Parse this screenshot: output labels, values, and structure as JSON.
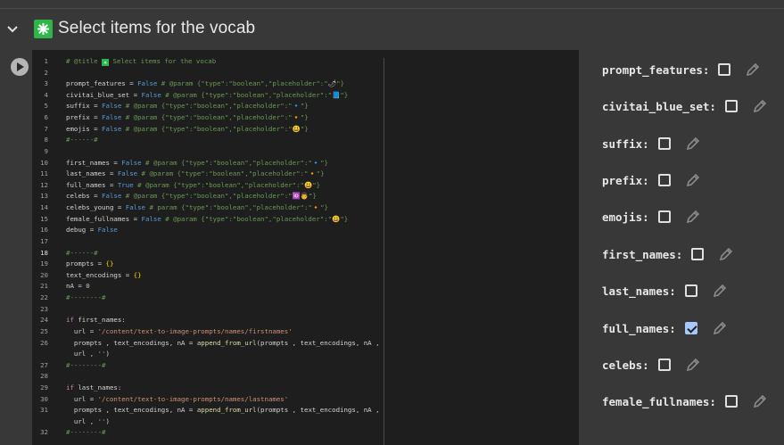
{
  "header": {
    "title": "Select items for the vocab",
    "title_emoji": "✳",
    "chevron_icon": "chevron-down-icon"
  },
  "code_lines": [
    {
      "n": "1",
      "segs": [
        [
          "cm",
          "# @title "
        ],
        [
          "em",
          "✳"
        ],
        [
          "cm",
          " Select items for the vocab"
        ]
      ]
    },
    {
      "n": "2",
      "segs": []
    },
    {
      "n": "3",
      "segs": [
        [
          "pl",
          "prompt_features = "
        ],
        [
          "bl",
          "False"
        ],
        [
          "cm",
          " # @param {\"type\":\"boolean\",\"placeholder\":\""
        ],
        [
          "pl",
          "🌶"
        ],
        [
          "cm",
          "\"}"
        ]
      ]
    },
    {
      "n": "4",
      "segs": [
        [
          "pl",
          "civitai_blue_set = "
        ],
        [
          "bl",
          "False"
        ],
        [
          "cm",
          " # @param {\"type\":\"boolean\",\"placeholder\":\""
        ],
        [
          "pl",
          "📘"
        ],
        [
          "cm",
          "\"}"
        ]
      ]
    },
    {
      "n": "5",
      "segs": [
        [
          "pl",
          "suffix = "
        ],
        [
          "bl",
          "False"
        ],
        [
          "cm",
          " # @param {\"type\":\"boolean\",\"placeholder\":\""
        ],
        [
          "pl",
          "🔹"
        ],
        [
          "cm",
          "\"}"
        ]
      ]
    },
    {
      "n": "6",
      "segs": [
        [
          "pl",
          "prefix = "
        ],
        [
          "bl",
          "False"
        ],
        [
          "cm",
          " # @param {\"type\":\"boolean\",\"placeholder\":\""
        ],
        [
          "pl",
          "🔸"
        ],
        [
          "cm",
          "\"}"
        ]
      ]
    },
    {
      "n": "7",
      "segs": [
        [
          "pl",
          "emojis = "
        ],
        [
          "bl",
          "False"
        ],
        [
          "cm",
          " # @param {\"type\":\"boolean\",\"placeholder\":\""
        ],
        [
          "pl",
          "😃"
        ],
        [
          "cm",
          "\"}"
        ]
      ]
    },
    {
      "n": "8",
      "segs": [
        [
          "cm",
          "#------#"
        ]
      ]
    },
    {
      "n": "9",
      "segs": []
    },
    {
      "n": "10",
      "segs": [
        [
          "pl",
          "first_names = "
        ],
        [
          "bl",
          "False"
        ],
        [
          "cm",
          " # @param {\"type\":\"boolean\",\"placeholder\":\""
        ],
        [
          "pl",
          "🔹"
        ],
        [
          "cm",
          "\"}"
        ]
      ]
    },
    {
      "n": "11",
      "segs": [
        [
          "pl",
          "last_names = "
        ],
        [
          "bl",
          "False"
        ],
        [
          "cm",
          " # @param {\"type\":\"boolean\",\"placeholder\":\""
        ],
        [
          "pl",
          "🔸"
        ],
        [
          "cm",
          "\"}"
        ]
      ]
    },
    {
      "n": "12",
      "segs": [
        [
          "pl",
          "full_names = "
        ],
        [
          "bl",
          "True"
        ],
        [
          "cm",
          " # @param {\"type\":\"boolean\",\"placeholder\":\""
        ],
        [
          "pl",
          "😃"
        ],
        [
          "cm",
          "\"}"
        ]
      ]
    },
    {
      "n": "13",
      "segs": [
        [
          "pl",
          "celebs = "
        ],
        [
          "bl",
          "False"
        ],
        [
          "cm",
          " # @param {\"type\":\"boolean\",\"placeholder\":\""
        ],
        [
          "pl",
          "🆔👨"
        ],
        [
          "cm",
          "\"}"
        ]
      ]
    },
    {
      "n": "14",
      "segs": [
        [
          "pl",
          "celebs_young = "
        ],
        [
          "bl",
          "False"
        ],
        [
          "cm",
          " # param {\"type\":\"boolean\",\"placeholder\":\""
        ],
        [
          "pl",
          "🔸"
        ],
        [
          "cm",
          "\"}"
        ]
      ]
    },
    {
      "n": "15",
      "segs": [
        [
          "pl",
          "female_fullnames = "
        ],
        [
          "bl",
          "False"
        ],
        [
          "cm",
          " # @param {\"type\":\"boolean\",\"placeholder\":\""
        ],
        [
          "pl",
          "😃"
        ],
        [
          "cm",
          "\"}"
        ]
      ]
    },
    {
      "n": "16",
      "segs": [
        [
          "pl",
          "debug = "
        ],
        [
          "bl",
          "False"
        ]
      ]
    },
    {
      "n": "17",
      "segs": []
    },
    {
      "n": "18",
      "segs": [
        [
          "cm",
          "#------#"
        ]
      ]
    },
    {
      "n": "19",
      "segs": [
        [
          "pl",
          "prompts = "
        ],
        [
          "yl",
          "{}"
        ]
      ]
    },
    {
      "n": "20",
      "segs": [
        [
          "pl",
          "text_encodings = "
        ],
        [
          "yl",
          "{}"
        ]
      ]
    },
    {
      "n": "21",
      "segs": [
        [
          "pl",
          "nA = "
        ],
        [
          "nm",
          "0"
        ]
      ]
    },
    {
      "n": "22",
      "segs": [
        [
          "cm",
          "#--------#"
        ]
      ]
    },
    {
      "n": "23",
      "segs": []
    },
    {
      "n": "24",
      "segs": [
        [
          "kw",
          "if"
        ],
        [
          "pl",
          " first_names:"
        ]
      ]
    },
    {
      "n": "25",
      "segs": [
        [
          "pl",
          "  url = "
        ],
        [
          "st",
          "'/content/text-to-image-prompts/names/firstnames'"
        ]
      ]
    },
    {
      "n": "26",
      "segs": [
        [
          "pl",
          "  prompts , text_encodings, nA = "
        ],
        [
          "fn",
          "append_from_url"
        ],
        [
          "pl",
          "(prompts , text_encodings, nA ,"
        ]
      ]
    },
    {
      "n": "",
      "segs": [
        [
          "pl",
          "  url , "
        ],
        [
          "st",
          "''"
        ],
        [
          "pl",
          ")"
        ]
      ]
    },
    {
      "n": "27",
      "segs": [
        [
          "cm",
          "#--------#"
        ]
      ]
    },
    {
      "n": "28",
      "segs": []
    },
    {
      "n": "29",
      "segs": [
        [
          "kw",
          "if"
        ],
        [
          "pl",
          " last_names:"
        ]
      ]
    },
    {
      "n": "30",
      "segs": [
        [
          "pl",
          "  url = "
        ],
        [
          "st",
          "'/content/text-to-image-prompts/names/lastnames'"
        ]
      ]
    },
    {
      "n": "31",
      "segs": [
        [
          "pl",
          "  prompts , text_encodings, nA = "
        ],
        [
          "fn",
          "append_from_url"
        ],
        [
          "pl",
          "(prompts , text_encodings, nA ,"
        ]
      ]
    },
    {
      "n": "",
      "segs": [
        [
          "pl",
          "  url , "
        ],
        [
          "st",
          "''"
        ],
        [
          "pl",
          ")"
        ]
      ]
    },
    {
      "n": "32",
      "segs": [
        [
          "cm",
          "#--------#"
        ]
      ]
    }
  ],
  "form": {
    "fields": [
      {
        "label": "prompt_features:",
        "checked": false
      },
      {
        "label": "civitai_blue_set:",
        "checked": false
      },
      {
        "label": "suffix:",
        "checked": false
      },
      {
        "label": "prefix:",
        "checked": false
      },
      {
        "label": "emojis:",
        "checked": false
      },
      {
        "label": "first_names:",
        "checked": false
      },
      {
        "label": "last_names:",
        "checked": false
      },
      {
        "label": "full_names:",
        "checked": true
      },
      {
        "label": "celebs:",
        "checked": false
      },
      {
        "label": "female_fullnames:",
        "checked": false
      }
    ]
  }
}
